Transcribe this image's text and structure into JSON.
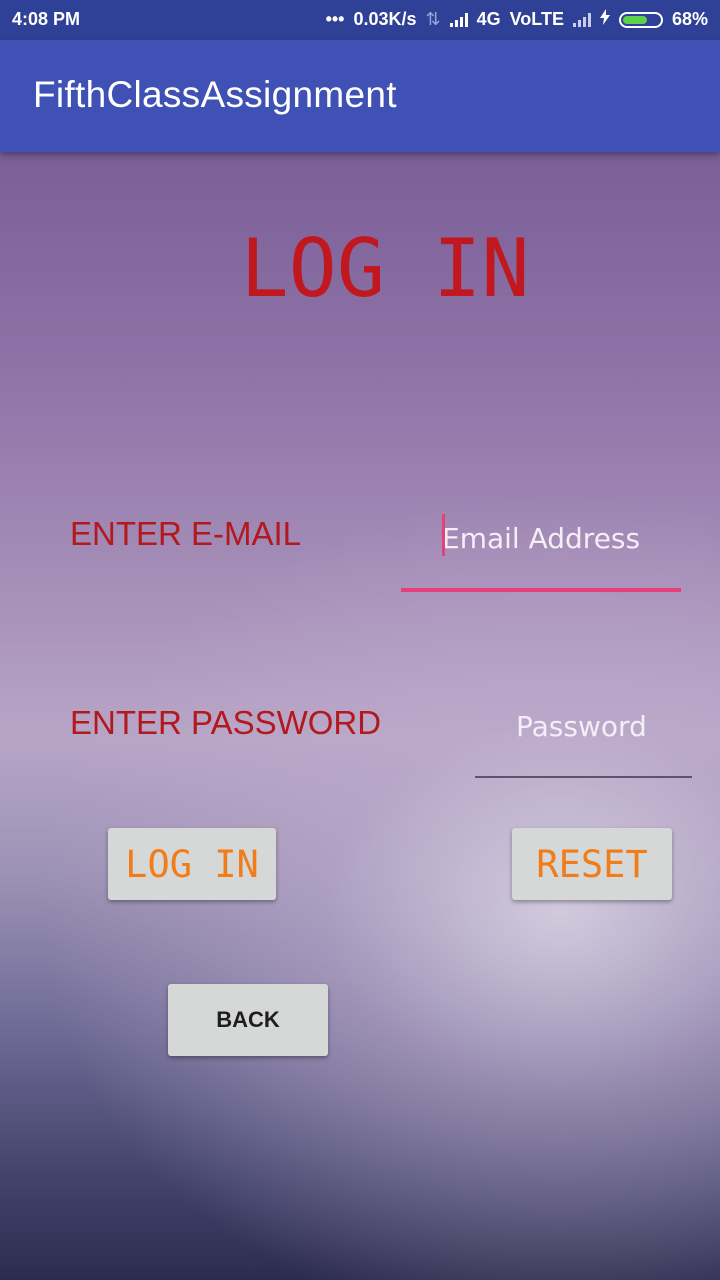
{
  "status_bar": {
    "time": "4:08 PM",
    "dots": "•••",
    "speed": "0.03K/s",
    "transfer_glyph": "⇅",
    "network": "4G",
    "volte": "VoLTE",
    "charging_glyph": "ϟ",
    "battery_percent": "68%",
    "battery_level": 0.68,
    "icons": [
      "data-transfer-icon",
      "signal-icon",
      "charging-icon",
      "battery-icon"
    ]
  },
  "app_bar": {
    "title": "FifthClassAssignment"
  },
  "login": {
    "heading": "LOG IN",
    "email_label": "ENTER E-MAIL",
    "email_placeholder": "Email Address",
    "password_label": "ENTER PASSWORD",
    "password_placeholder": "Password",
    "login_button": "LOG IN",
    "reset_button": "RESET",
    "back_button": "BACK"
  },
  "colors": {
    "status_bar": "#2f4197",
    "app_bar": "#3f51b5",
    "label_red": "#b3181c",
    "button_orange": "#ef7d1a",
    "accent_pink": "#e6407a",
    "button_bg": "#d6d7d7"
  }
}
